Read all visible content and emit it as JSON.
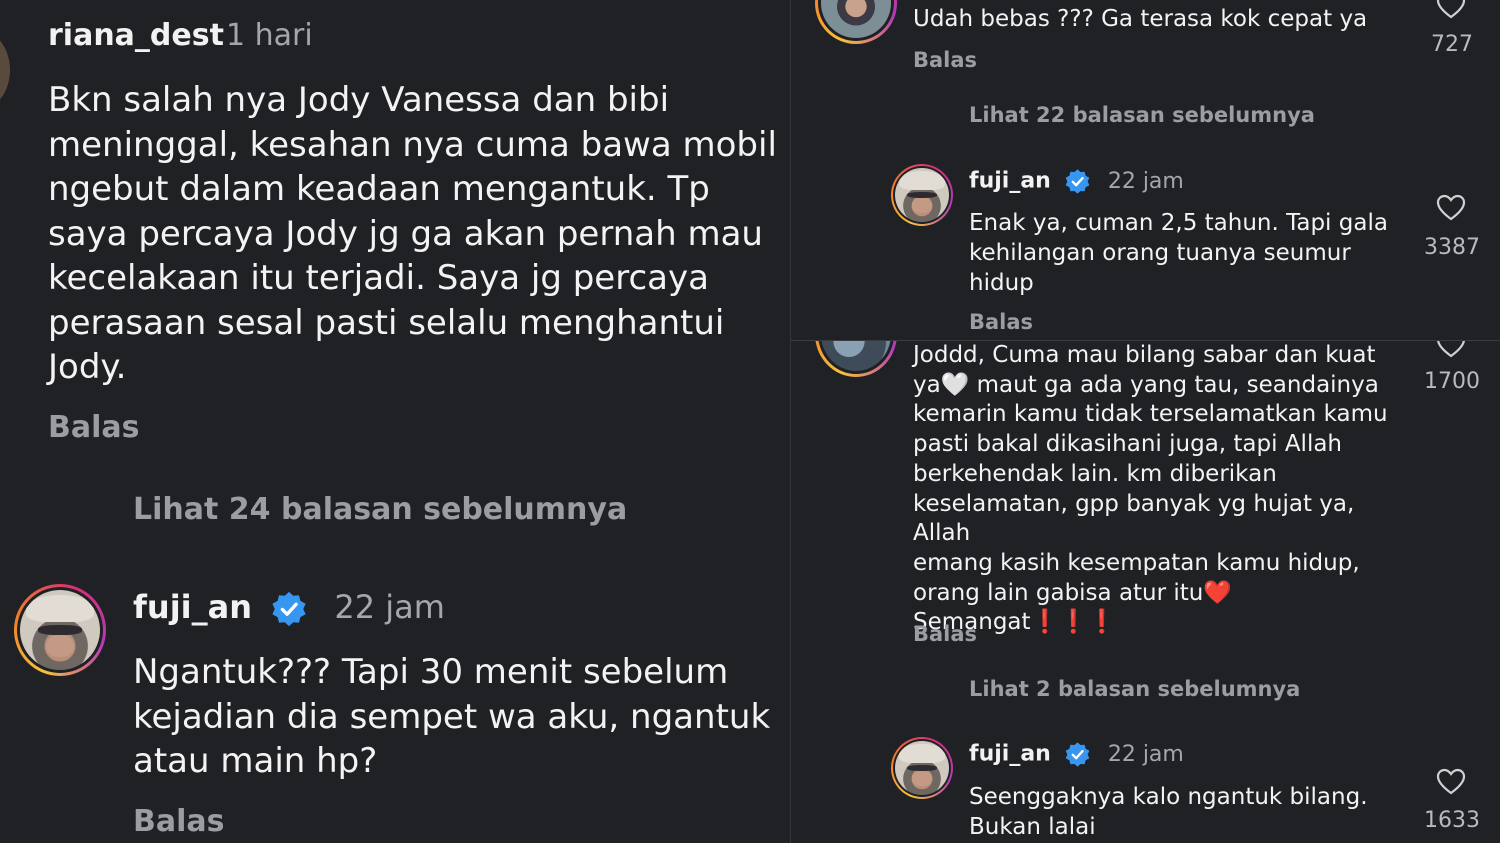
{
  "left": {
    "top_comment": {
      "username": "riana_dest",
      "time": "1 hari",
      "text": "Bkn salah nya Jody Vanessa dan bibi\nmeninggal, kesahan nya cuma bawa mobil\nngebut dalam keadaan mengantuk. Tp\nsaya percaya Jody jg ga akan pernah mau\nkecelakaan itu terjadi. Saya jg percaya\nperasaan sesal pasti selalu menghantui\nJody.",
      "reply_label": "Balas"
    },
    "view_replies": "Lihat 24 balasan sebelumnya",
    "reply": {
      "username": "fuji_an",
      "time": "22 jam",
      "text": "Ngantuk??? Tapi 30 menit sebelum\nkejadian dia sempet wa aku, ngantuk\natau main hp?",
      "reply_label": "Balas"
    }
  },
  "right_top": {
    "top_comment": {
      "text": "Udah bebas ??? Ga terasa kok cepat ya",
      "likes": "727",
      "reply_label": "Balas"
    },
    "view_replies": "Lihat 22 balasan sebelumnya",
    "reply": {
      "username": "fuji_an",
      "time": "22 jam",
      "text": "Enak ya, cuman 2,5 tahun. Tapi gala\nkehilangan orang tuanya seumur\nhidup",
      "likes": "3387",
      "reply_label": "Balas"
    }
  },
  "right_bottom": {
    "top_comment": {
      "text": "Joddd, Cuma mau bilang sabar dan kuat\nya🤍 maut ga ada yang tau, seandainya\nkemarin kamu tidak terselamatkan kamu\npasti bakal dikasihani juga, tapi Allah\nberkehendak lain. km diberikan\nkeselamatan, gpp banyak yg hujat ya, Allah\nemang kasih kesempatan kamu hidup,\norang lain gabisa atur itu❤️\nSemangat❗❗❗",
      "likes": "1700",
      "reply_label": "Balas"
    },
    "view_replies": "Lihat 2 balasan sebelumnya",
    "reply": {
      "username": "fuji_an",
      "time": "22 jam",
      "text": "Seenggaknya kalo ngantuk bilang.\nBukan lalai",
      "likes": "1633"
    }
  },
  "colors": {
    "background": "#202125",
    "verified_blue": "#3797f0",
    "muted_text": "#9b9da2"
  },
  "icons": [
    "verified-badge-icon",
    "heart-icon",
    "avatar"
  ]
}
